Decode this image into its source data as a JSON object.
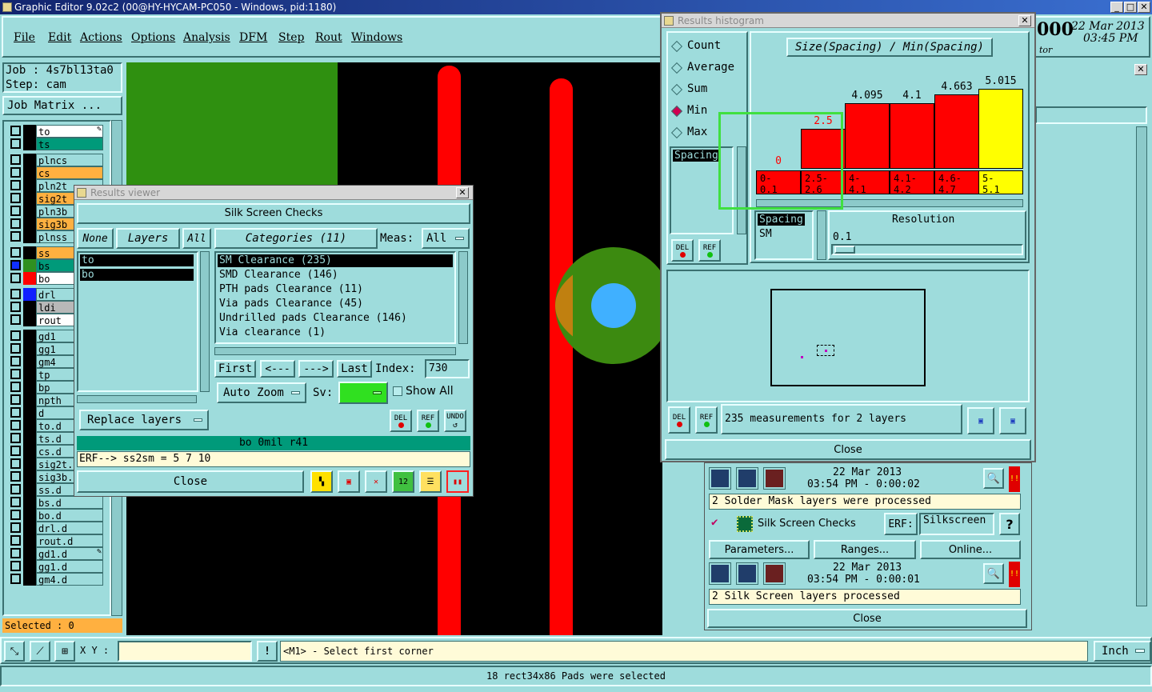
{
  "app": {
    "title": "Graphic Editor 9.02c2 (00@HY-HYCAM-PC050 - Windows, pid:1180)"
  },
  "menu": [
    "File",
    "Edit",
    "Actions",
    "Options",
    "Analysis",
    "DFM",
    "Step",
    "Rout",
    "Windows"
  ],
  "clock": {
    "date": "22 Mar 2013",
    "time": "03:45 PM",
    "partial": "000",
    "partial2": "tor"
  },
  "job": {
    "job": "Job : 4s7bl13ta0",
    "step": "Step: cam",
    "matrix_btn": "Job Matrix ..."
  },
  "layers": [
    {
      "name": "to",
      "color": "#000000",
      "bg": "#ffffff",
      "mark": "✎"
    },
    {
      "name": "ts",
      "color": "#000000",
      "bg": "#009a7a"
    },
    {
      "name": "plncs",
      "color": "#000000",
      "bg": "#9edcdc"
    },
    {
      "name": "cs",
      "color": "#000000",
      "bg": "#ffb040"
    },
    {
      "name": "pln2t",
      "color": "#000000",
      "bg": "#9edcdc"
    },
    {
      "name": "sig2t",
      "color": "#000000",
      "bg": "#ffb040"
    },
    {
      "name": "pln3b",
      "color": "#000000",
      "bg": "#9edcdc"
    },
    {
      "name": "sig3b",
      "color": "#000000",
      "bg": "#ffb040"
    },
    {
      "name": "plnss",
      "color": "#000000",
      "bg": "#9edcdc"
    },
    {
      "name": "ss",
      "color": "#000000",
      "bg": "#ffb040"
    },
    {
      "name": "bs",
      "color": "#2f9020",
      "bg": "#009a7a"
    },
    {
      "name": "bo",
      "color": "#ff0000",
      "bg": "#ffffff"
    },
    {
      "name": "drl",
      "color": "#1020ff",
      "bg": "#9edcdc"
    },
    {
      "name": "ldi",
      "color": "#000000",
      "bg": "#b8b8b8"
    },
    {
      "name": "rout",
      "color": "#000000",
      "bg": "#ffffff"
    },
    {
      "name": "gd1",
      "color": "#000000",
      "bg": "#9edcdc"
    },
    {
      "name": "gg1",
      "color": "#000000",
      "bg": "#9edcdc"
    },
    {
      "name": "gm4",
      "color": "#000000",
      "bg": "#9edcdc"
    },
    {
      "name": "tp",
      "color": "#000000",
      "bg": "#9edcdc"
    },
    {
      "name": "bp",
      "color": "#000000",
      "bg": "#9edcdc"
    },
    {
      "name": "npth",
      "color": "#000000",
      "bg": "#9edcdc"
    },
    {
      "name": "d",
      "color": "#000000",
      "bg": "#9edcdc"
    },
    {
      "name": "to.d",
      "color": "#000000",
      "bg": "#9edcdc"
    },
    {
      "name": "ts.d",
      "color": "#000000",
      "bg": "#9edcdc"
    },
    {
      "name": "cs.d",
      "color": "#000000",
      "bg": "#9edcdc"
    },
    {
      "name": "sig2t.d",
      "color": "#000000",
      "bg": "#9edcdc"
    },
    {
      "name": "sig3b.d",
      "color": "#000000",
      "bg": "#9edcdc"
    },
    {
      "name": "ss.d",
      "color": "#000000",
      "bg": "#9edcdc",
      "mark": "✎"
    },
    {
      "name": "bs.d",
      "color": "#000000",
      "bg": "#9edcdc"
    },
    {
      "name": "bo.d",
      "color": "#000000",
      "bg": "#9edcdc"
    },
    {
      "name": "drl.d",
      "color": "#000000",
      "bg": "#9edcdc"
    },
    {
      "name": "rout.d",
      "color": "#000000",
      "bg": "#9edcdc"
    },
    {
      "name": "gd1.d",
      "color": "#000000",
      "bg": "#9edcdc",
      "mark": "✎"
    },
    {
      "name": "gg1.d",
      "color": "#000000",
      "bg": "#9edcdc"
    },
    {
      "name": "gm4.d",
      "color": "#000000",
      "bg": "#9edcdc"
    }
  ],
  "selected": "Selected : 0",
  "bottom": {
    "xy_label": "X Y :",
    "prompt": "<M1> - Select first corner",
    "unit": "Inch",
    "status": "18 rect34x86 Pads were selected"
  },
  "results_viewer": {
    "title": "Results viewer",
    "heading": "Silk Screen Checks",
    "none": "None",
    "layers": "Layers",
    "all": "All",
    "categories": "Categories (11)",
    "meas": "Meas:",
    "meas_val": "All",
    "layer_items": [
      "to",
      "bo"
    ],
    "cat_items": [
      "SM Clearance (235)",
      "SMD Clearance (146)",
      "PTH pads Clearance (11)",
      "Via pads Clearance (45)",
      "Undrilled pads Clearance (146)",
      "Via clearance (1)"
    ],
    "first": "First",
    "prev": "<---",
    "next": "--->",
    "last": "Last",
    "index_label": "Index:",
    "index_val": "730",
    "autozoom": "Auto Zoom",
    "sv": "Sv:",
    "showall": "Show All",
    "replace": "Replace layers",
    "del": "DEL",
    "ref": "REF",
    "undo": "UNDO",
    "info": "bo 0mil  r41",
    "erf": "ERF--> ss2sm = 5 7 10",
    "close": "Close"
  },
  "histogram": {
    "title": "Results histogram",
    "modes": [
      "Count",
      "Average",
      "Sum",
      "Min",
      "Max"
    ],
    "mode_selected": "Min",
    "chart_title": "Size(Spacing) / Min(Spacing)",
    "list_label": "Spacing",
    "spacing_head": "Spacing",
    "spacing_val": "SM",
    "resolution_label": "Resolution",
    "resolution_val": "0.1",
    "del": "DEL",
    "ref": "REF",
    "summary": "235 measurements for 2 layers",
    "close": "Close"
  },
  "chart_data": {
    "type": "bar",
    "title": "Size(Spacing) / Min(Spacing)",
    "categories": [
      "0-\n0.1",
      "2.5-\n2.6",
      "4-\n4.1",
      "4.1-\n4.2",
      "4.6-\n4.7",
      "5-\n5.1"
    ],
    "values": [
      0,
      2.5,
      4.095,
      4.1,
      4.663,
      5.015
    ],
    "value_labels": [
      "0",
      "2.5",
      "4.095",
      "4.1",
      "4.663",
      "5.015"
    ],
    "colors": [
      "#ff0000",
      "#ff0000",
      "#ff0000",
      "#ff0000",
      "#ff0000",
      "#ffff00"
    ],
    "label_colors": [
      "#ff0000",
      "#ff0000",
      "#000000",
      "#000000",
      "#000000",
      "#000000"
    ],
    "ylim": [
      0,
      5.015
    ]
  },
  "right_panel": {
    "date1": "22 Mar 2013",
    "time1": "03:54 PM - 0:00:02",
    "msg1": "2 Solder Mask layers were processed",
    "check_name": "Silk Screen Checks",
    "erf_label": "ERF:",
    "erf_val": "Silkscreen",
    "help": "?",
    "params": "Parameters...",
    "ranges": "Ranges...",
    "online": "Online...",
    "date2": "22 Mar 2013",
    "time2": "03:54 PM - 0:00:01",
    "msg2": "2 Silk Screen layers processed",
    "close": "Close",
    "warn": "!!"
  }
}
